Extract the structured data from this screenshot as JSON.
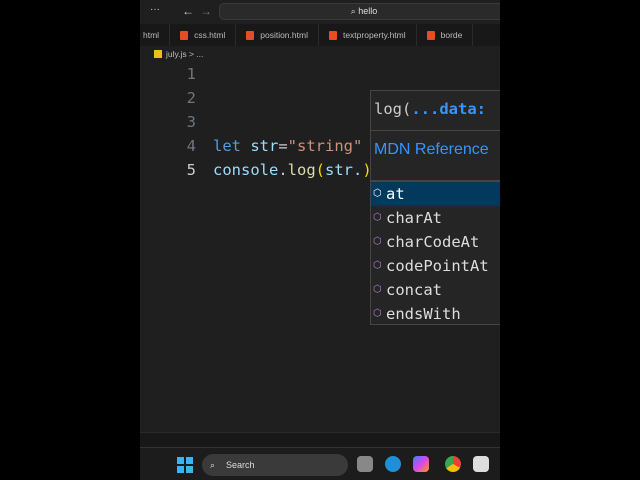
{
  "titlebar": {
    "search_text": "hello",
    "more": "···",
    "back": "←",
    "forward": "→"
  },
  "tabs": [
    {
      "label": "html"
    },
    {
      "label": "css.html"
    },
    {
      "label": "position.html"
    },
    {
      "label": "textproperty.html"
    },
    {
      "label": "borde"
    }
  ],
  "breadcrumb": {
    "file": "july.js",
    "sep": "> ..."
  },
  "editor": {
    "line_numbers": [
      "1",
      "2",
      "3",
      "4",
      "5"
    ],
    "line4": {
      "kw": "let",
      "var": " str",
      "op": "=",
      "str": "\"string\""
    },
    "line5": {
      "obj": "console",
      "dot": ".",
      "fn": "log",
      "open": "(",
      "arg": "str.",
      "close": ")"
    }
  },
  "hover": {
    "signature_fn": "log(",
    "signature_params": "...data:",
    "link": "MDN Reference"
  },
  "suggestions": [
    {
      "label": "at",
      "selected": true
    },
    {
      "label": "charAt"
    },
    {
      "label": "charCodeAt"
    },
    {
      "label": "codePointAt"
    },
    {
      "label": "concat"
    },
    {
      "label": "endsWith"
    }
  ],
  "taskbar": {
    "search_label": "Search"
  }
}
